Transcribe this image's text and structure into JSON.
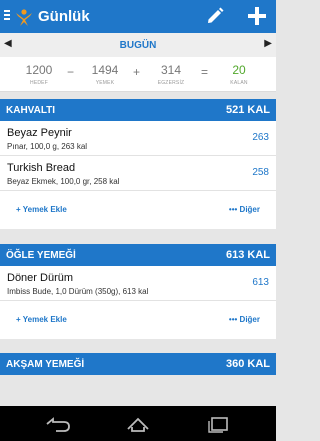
{
  "header": {
    "title": "Günlük",
    "menu_icon": "hamburger-icon",
    "logo_icon": "app-logo",
    "edit_icon": "pencil-icon",
    "add_icon": "plus-icon"
  },
  "date_bar": {
    "label": "BUGÜN",
    "prev_arrow": "◀",
    "next_arrow": "▶"
  },
  "summary": {
    "goal": {
      "value": "1200",
      "label": "HEDEF"
    },
    "minus": "−",
    "food": {
      "value": "1494",
      "label": "YEMEK"
    },
    "plus": "+",
    "exercise": {
      "value": "314",
      "label": "EGZERSİZ"
    },
    "equals": "=",
    "remaining": {
      "value": "20",
      "label": "KALAN"
    }
  },
  "meals": [
    {
      "name": "KAHVALTI",
      "kcal": "521 KAL",
      "items": [
        {
          "name": "Beyaz Peynir",
          "desc": "Pınar, 100,0 g, 263 kal",
          "kcal": "263"
        },
        {
          "name": "Turkish Bread",
          "desc": "Beyaz Ekmek, 100,0 gr, 258 kal",
          "kcal": "258"
        }
      ],
      "add_label": "+ Yemek Ekle",
      "more_label": "••• Diğer"
    },
    {
      "name": "ÖĞLE YEMEĞİ",
      "kcal": "613 KAL",
      "items": [
        {
          "name": "Döner Dürüm",
          "desc": "Imbiss Bude, 1,0 Dürüm (350g), 613 kal",
          "kcal": "613"
        }
      ],
      "add_label": "+ Yemek Ekle",
      "more_label": "••• Diğer"
    },
    {
      "name": "AKŞAM YEMEĞİ",
      "kcal": "360 KAL"
    }
  ],
  "colors": {
    "primary": "#1f77c9",
    "remaining_green": "#52a82c",
    "background": "#e6e6e6"
  },
  "system_nav": {
    "back_icon": "back-icon",
    "home_icon": "home-icon",
    "recents_icon": "recents-icon"
  }
}
